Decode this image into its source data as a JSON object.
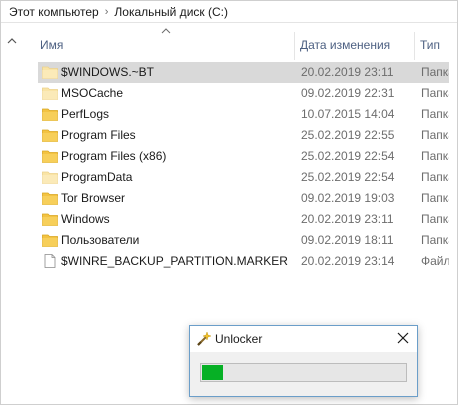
{
  "breadcrumb": {
    "items": [
      "Этот компьютер",
      "Локальный диск (C:)"
    ]
  },
  "columns": {
    "name": "Имя",
    "date": "Дата изменения",
    "type": "Тип"
  },
  "files": [
    {
      "name": "$WINDOWS.~BT",
      "date": "20.02.2019 23:11",
      "type": "Папка",
      "icon": "folder-faded-icon",
      "selected": true
    },
    {
      "name": "MSOCache",
      "date": "09.02.2019 22:31",
      "type": "Папка",
      "icon": "folder-faded-icon",
      "selected": false
    },
    {
      "name": "PerfLogs",
      "date": "10.07.2015 14:04",
      "type": "Папка",
      "icon": "folder-icon",
      "selected": false
    },
    {
      "name": "Program Files",
      "date": "25.02.2019 22:55",
      "type": "Папка",
      "icon": "folder-icon",
      "selected": false
    },
    {
      "name": "Program Files (x86)",
      "date": "25.02.2019 22:54",
      "type": "Папка",
      "icon": "folder-icon",
      "selected": false
    },
    {
      "name": "ProgramData",
      "date": "25.02.2019 22:54",
      "type": "Папка",
      "icon": "folder-faded-icon",
      "selected": false
    },
    {
      "name": "Tor Browser",
      "date": "09.02.2019 19:03",
      "type": "Папка",
      "icon": "folder-icon",
      "selected": false
    },
    {
      "name": "Windows",
      "date": "20.02.2019 23:11",
      "type": "Папка",
      "icon": "folder-icon",
      "selected": false
    },
    {
      "name": "Пользователи",
      "date": "09.02.2019 18:11",
      "type": "Папка",
      "icon": "folder-icon",
      "selected": false
    },
    {
      "name": "$WINRE_BACKUP_PARTITION.MARKER",
      "date": "20.02.2019 23:14",
      "type": "Файл \"",
      "icon": "file-icon",
      "selected": false
    }
  ],
  "dialog": {
    "title": "Unlocker",
    "icon": "wand-icon",
    "progress": 0.1
  },
  "colors": {
    "selected_row": "#d9d9d9",
    "folder": "#f3c342",
    "progress_fill": "#06b025",
    "header_text": "#4d6082"
  }
}
